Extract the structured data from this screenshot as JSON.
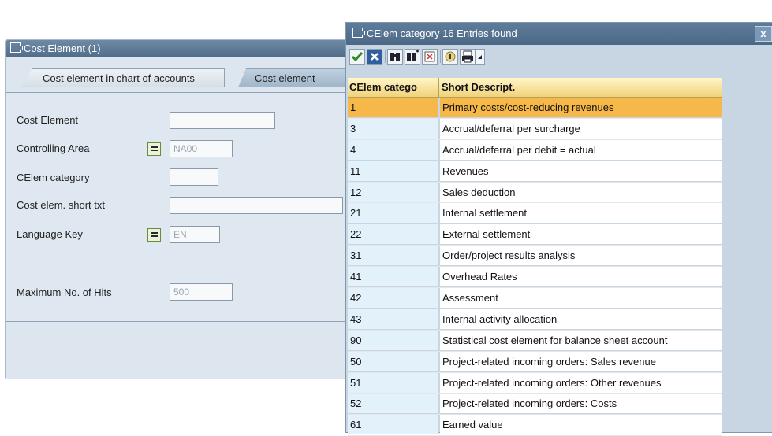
{
  "background_window": {
    "title": "Cost Element (1)",
    "tabs": [
      {
        "label": "Cost element in chart of accounts"
      },
      {
        "label": "Cost element"
      }
    ],
    "fields": {
      "cost_element": {
        "label": "Cost Element",
        "value": ""
      },
      "controlling_area": {
        "label": "Controlling Area",
        "value": "NA00"
      },
      "celem_category": {
        "label": "CElem category",
        "value": ""
      },
      "cost_elem_short_txt": {
        "label": "Cost elem. short txt",
        "value": ""
      },
      "language_key": {
        "label": "Language Key",
        "value": "EN"
      },
      "max_hits": {
        "label": "Maximum No. of Hits",
        "value": "500"
      }
    }
  },
  "popup": {
    "title": "CElem category  16 Entries found",
    "close_label": "x",
    "columns": [
      "CElem catego",
      "Short Descript."
    ],
    "rows": [
      {
        "code": "1",
        "description": "Primary costs/cost-reducing revenues",
        "selected": true
      },
      {
        "code": "3",
        "description": "Accrual/deferral per surcharge"
      },
      {
        "code": "4",
        "description": "Accrual/deferral per debit = actual"
      },
      {
        "code": "11",
        "description": "Revenues"
      },
      {
        "code": "12",
        "description": "Sales deduction"
      },
      {
        "code": "21",
        "description": "Internal settlement"
      },
      {
        "code": "22",
        "description": "External settlement"
      },
      {
        "code": "31",
        "description": "Order/project results analysis"
      },
      {
        "code": "41",
        "description": "Overhead Rates"
      },
      {
        "code": "42",
        "description": "Assessment"
      },
      {
        "code": "43",
        "description": "Internal activity allocation"
      },
      {
        "code": "90",
        "description": "Statistical cost element for balance sheet account"
      },
      {
        "code": "50",
        "description": "Project-related incoming orders: Sales revenue"
      },
      {
        "code": "51",
        "description": "Project-related incoming orders: Other revenues"
      },
      {
        "code": "52",
        "description": "Project-related incoming orders: Costs"
      },
      {
        "code": "61",
        "description": "Earned value"
      }
    ]
  },
  "colors": {
    "selected_row": "#f7b84a",
    "titlebar": "#4f6c89",
    "code_column": "#e3f1fb"
  }
}
